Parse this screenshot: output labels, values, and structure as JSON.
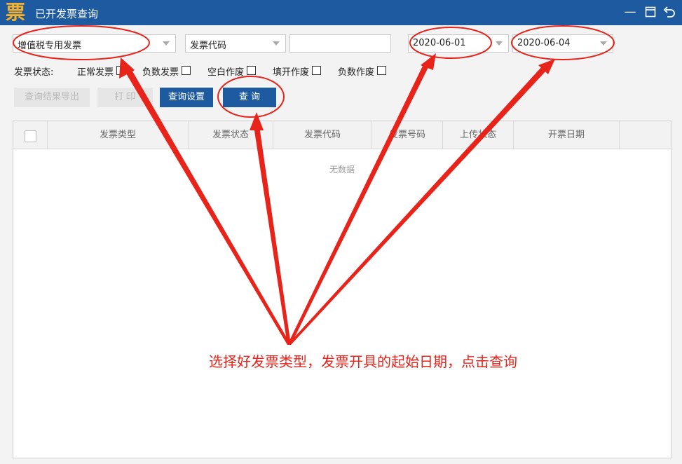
{
  "window": {
    "logo_char": "票",
    "title": "已开发票查询",
    "minimize": "—",
    "maximize": "▭",
    "back": "↶"
  },
  "filters": {
    "invoice_type": "增值税专用发票",
    "invoice_code_select": "发票代码",
    "code_input_value": "",
    "start_date": "2020-06-01",
    "end_date": "2020-06-04"
  },
  "status": {
    "label": "发票状态:",
    "options": [
      "正常发票",
      "负数发票",
      "空白作废",
      "填开作废",
      "负数作废"
    ]
  },
  "buttons": {
    "export": "查询结果导出",
    "print": "打 印",
    "settings": "查询设置",
    "query": "查 询"
  },
  "table": {
    "columns": [
      "发票类型",
      "发票状态",
      "发票代码",
      "发票号码",
      "上传状态",
      "开票日期"
    ],
    "empty_text": "无数据"
  },
  "annotation": {
    "text": "选择好发票类型，发票开具的起始日期，点击查询",
    "color": "#e8231a"
  },
  "colors": {
    "brand": "#1d5aa0",
    "logo": "#f4b12c"
  }
}
